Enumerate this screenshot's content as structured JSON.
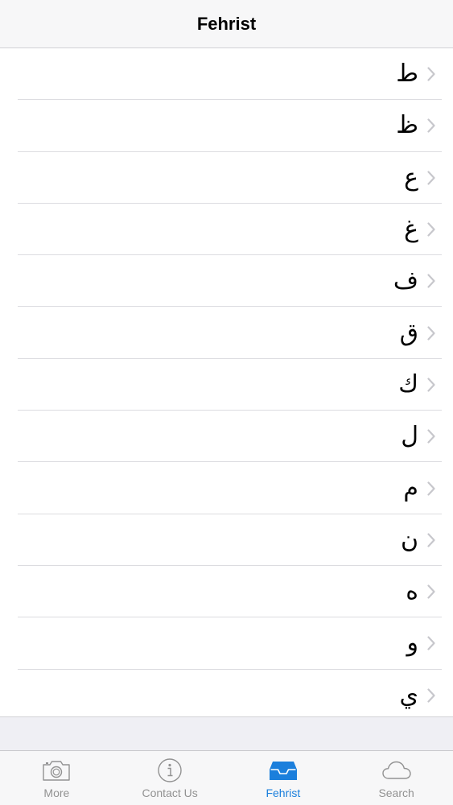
{
  "nav": {
    "title": "Fehrist"
  },
  "list": {
    "items": [
      {
        "label": "ط"
      },
      {
        "label": "ظ"
      },
      {
        "label": "ع"
      },
      {
        "label": "غ"
      },
      {
        "label": "ف"
      },
      {
        "label": "ق"
      },
      {
        "label": "ك"
      },
      {
        "label": "ل"
      },
      {
        "label": "م"
      },
      {
        "label": "ن"
      },
      {
        "label": "ه"
      },
      {
        "label": "و"
      },
      {
        "label": "ي"
      }
    ]
  },
  "tabbar": {
    "tabs": [
      {
        "label": "More",
        "icon": "camera-icon",
        "active": false
      },
      {
        "label": "Contact Us",
        "icon": "info-icon",
        "active": false
      },
      {
        "label": "Fehrist",
        "icon": "inbox-tray-icon",
        "active": true
      },
      {
        "label": "Search",
        "icon": "cloud-icon",
        "active": false
      }
    ]
  },
  "colors": {
    "accent": "#1b7fdc",
    "inactive": "#929292",
    "background": "#efeff4",
    "separator": "#dcdce0"
  }
}
